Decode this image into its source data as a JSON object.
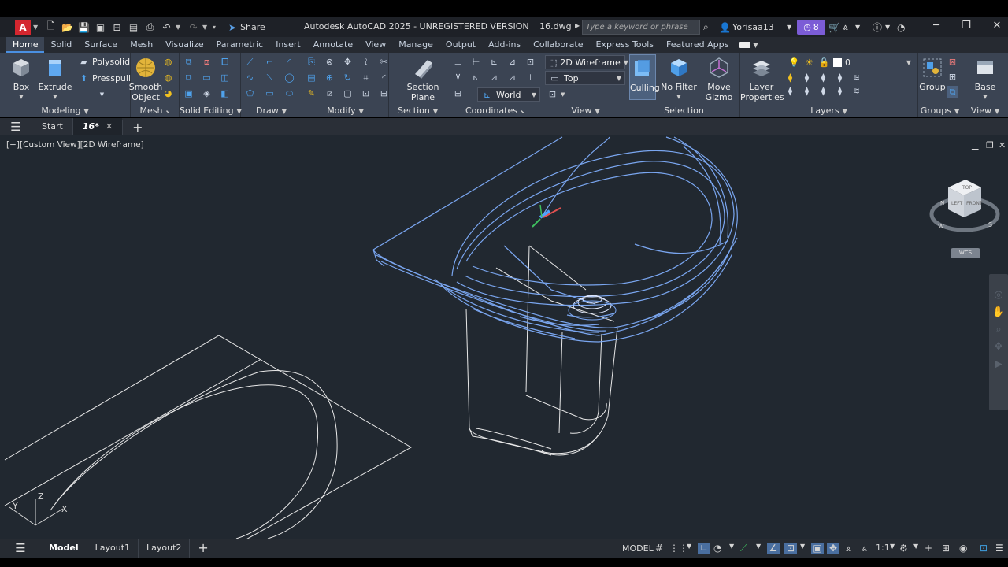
{
  "titlebar": {
    "logo": "A",
    "share_label": "Share",
    "app_title": "Autodesk AutoCAD 2025 - UNREGISTERED VERSION",
    "file_name": "16.dwg",
    "search_placeholder": "Type a keyword or phrase",
    "user_name": "Yorisaa13",
    "trial_count": "8"
  },
  "ribbon_tabs": [
    "Home",
    "Solid",
    "Surface",
    "Mesh",
    "Visualize",
    "Parametric",
    "Insert",
    "Annotate",
    "View",
    "Manage",
    "Output",
    "Add-ins",
    "Collaborate",
    "Express Tools",
    "Featured Apps"
  ],
  "ribbon": {
    "modeling": {
      "title": "Modeling",
      "box": "Box",
      "extrude": "Extrude",
      "polysolid": "Polysolid",
      "presspull": "Presspull"
    },
    "mesh": {
      "title": "Mesh",
      "smooth_line1": "Smooth",
      "smooth_line2": "Object"
    },
    "solid_editing": {
      "title": "Solid Editing"
    },
    "draw": {
      "title": "Draw"
    },
    "modify": {
      "title": "Modify"
    },
    "section": {
      "title": "Section",
      "plane_line1": "Section",
      "plane_line2": "Plane"
    },
    "coordinates": {
      "title": "Coordinates",
      "ucs_value": "World"
    },
    "view": {
      "title": "View",
      "visual_style": "2D Wireframe",
      "view_dir": "Top"
    },
    "selection": {
      "title": "Selection",
      "culling": "Culling",
      "no_filter": "No Filter",
      "move_line1": "Move",
      "move_line2": "Gizmo"
    },
    "layers": {
      "title": "Layers",
      "props_line1": "Layer",
      "props_line2": "Properties",
      "current_layer": "0"
    },
    "groups": {
      "title": "Groups",
      "group": "Group"
    },
    "view2": {
      "title": "View",
      "base": "Base"
    }
  },
  "file_tabs": {
    "start": "Start",
    "current": "16*"
  },
  "viewport": {
    "label": "[−][Custom View][2D Wireframe]",
    "viewcube_top": "TOP",
    "viewcube_left": "LEFT",
    "viewcube_front": "FRONT",
    "compass_w": "W",
    "compass_s": "S",
    "compass_n": "N",
    "wcs": "WCS",
    "ucs_y": "Y",
    "ucs_z": "Z",
    "ucs_x": "X"
  },
  "status": {
    "tabs": [
      "Model",
      "Layout1",
      "Layout2"
    ],
    "model_label": "MODEL",
    "scale": "1:1"
  },
  "colors": {
    "accent": "#4a90e2",
    "selection_blue": "#6fa0ff",
    "logo_red": "#d4262f",
    "trial_purple": "#7b5cd6"
  }
}
